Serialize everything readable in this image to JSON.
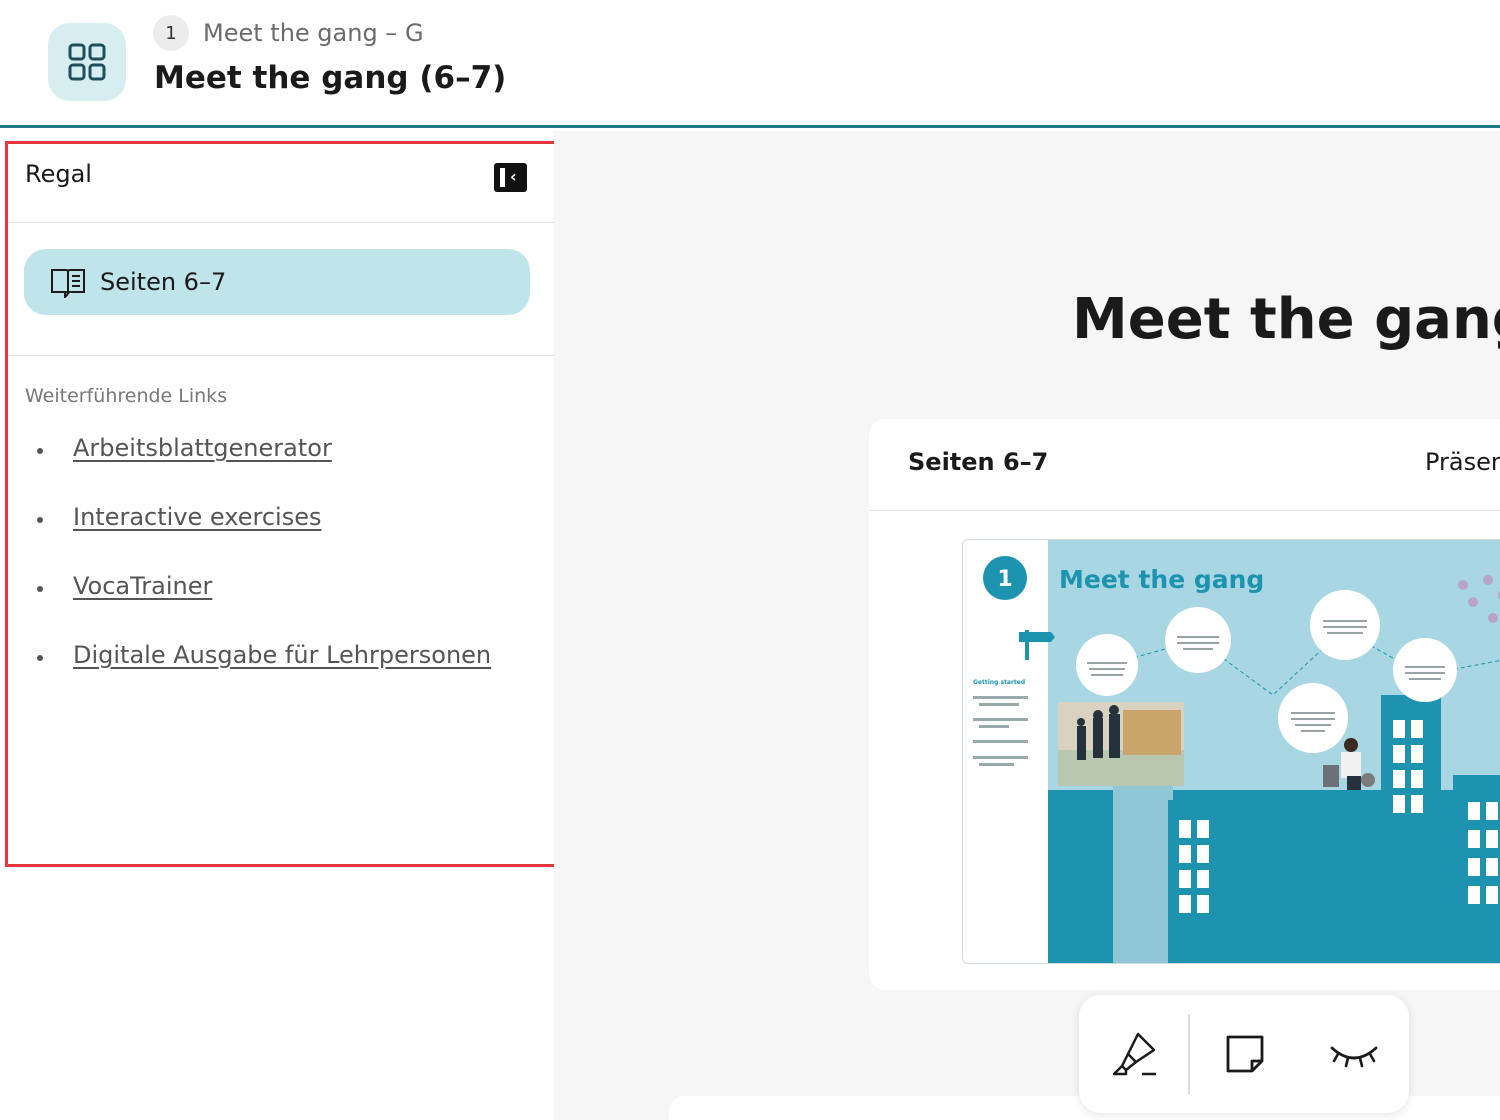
{
  "header": {
    "breadcrumb_number": "1",
    "breadcrumb_text": "Meet the gang – G",
    "title": "Meet the gang  (6–7)"
  },
  "sidebar": {
    "title": "Regal",
    "shelf_item": "Seiten 6–7",
    "links_heading": "Weiterführende Links",
    "links": [
      "Arbeitsblattgenerator",
      "Interactive exercises",
      "VocaTrainer",
      "Digitale Ausgabe für Lehrpersonen"
    ]
  },
  "main": {
    "hero_title": "Meet the gang",
    "card": {
      "title": "Seiten 6–7",
      "presentation_label": "Präsen",
      "thumbnail": {
        "unit_number": "1",
        "heading": "Meet the gang",
        "getting_started": "Getting started"
      }
    }
  },
  "colors": {
    "accent": "#1f7a8c",
    "shelf_highlight": "#bfe4ea",
    "app_tile": "#d7eef1",
    "selection_outline": "#e8383d",
    "book_blue": "#1d93b0"
  },
  "icons": {
    "app": "grid-icon",
    "collapse": "sidebar-collapse-icon",
    "shelf": "open-book-icon",
    "tools": [
      "highlighter-icon",
      "sticky-note-icon",
      "hide-eye-icon"
    ]
  }
}
